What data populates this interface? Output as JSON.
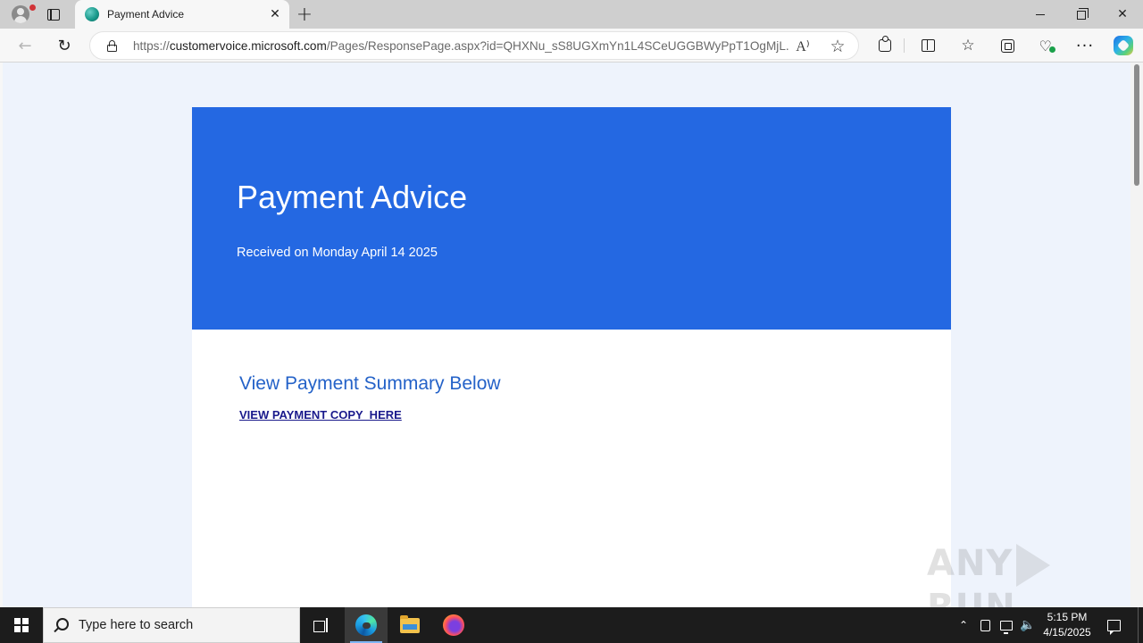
{
  "browser": {
    "tab": {
      "title": "Payment Advice",
      "favicon": "forms-favicon-icon",
      "close_glyph": "✕"
    },
    "new_tab_glyph": "+",
    "address": {
      "url_prefix": "https://",
      "url_host": "customervoice.microsoft.com",
      "url_path": "/Pages/ResponsePage.aspx?id=QHXNu_sS8UGXmYn1L4SCeUGGBWyPpT1OgMjL..."
    },
    "read_aloud_glyph": "A⁾",
    "favorite_glyph": "☆",
    "favorites_glyph": "☆",
    "more_glyph": "···",
    "back_glyph": "←",
    "refresh_glyph": "↻",
    "icons": [
      "profile-icon",
      "tab-actions-icon",
      "back-arrow-icon",
      "refresh-icon",
      "lock-icon",
      "read-aloud-icon",
      "star-icon",
      "extensions-icon",
      "split-screen-icon",
      "favorites-icon",
      "collections-icon",
      "browser-essentials-icon",
      "more-icon",
      "copilot-icon"
    ]
  },
  "page": {
    "header": {
      "title": "Payment Advice",
      "subtitle": "Received on Monday April 14 2025"
    },
    "section_heading": "View Payment Summary Below",
    "link_text": "VIEW PAYMENT COPY  HERE"
  },
  "watermark": {
    "left": "ANY",
    "right": "RUN"
  },
  "taskbar": {
    "search_placeholder": "Type here to search",
    "chevron_glyph": "⌃",
    "volume_glyph": "🔈",
    "clock": {
      "time": "5:15 PM",
      "date": "4/15/2025"
    },
    "icons": [
      "windows-start-icon",
      "search-icon",
      "task-view-icon",
      "edge-icon",
      "file-explorer-icon",
      "firefox-icon",
      "show-hidden-icons-icon",
      "meet-now-icon",
      "network-icon",
      "volume-icon",
      "notification-icon"
    ]
  },
  "colors": {
    "header_blue": "#2468e2",
    "heading_blue": "#2462c8",
    "link_navy": "#1a1a8c",
    "page_background": "#eef3fc"
  }
}
